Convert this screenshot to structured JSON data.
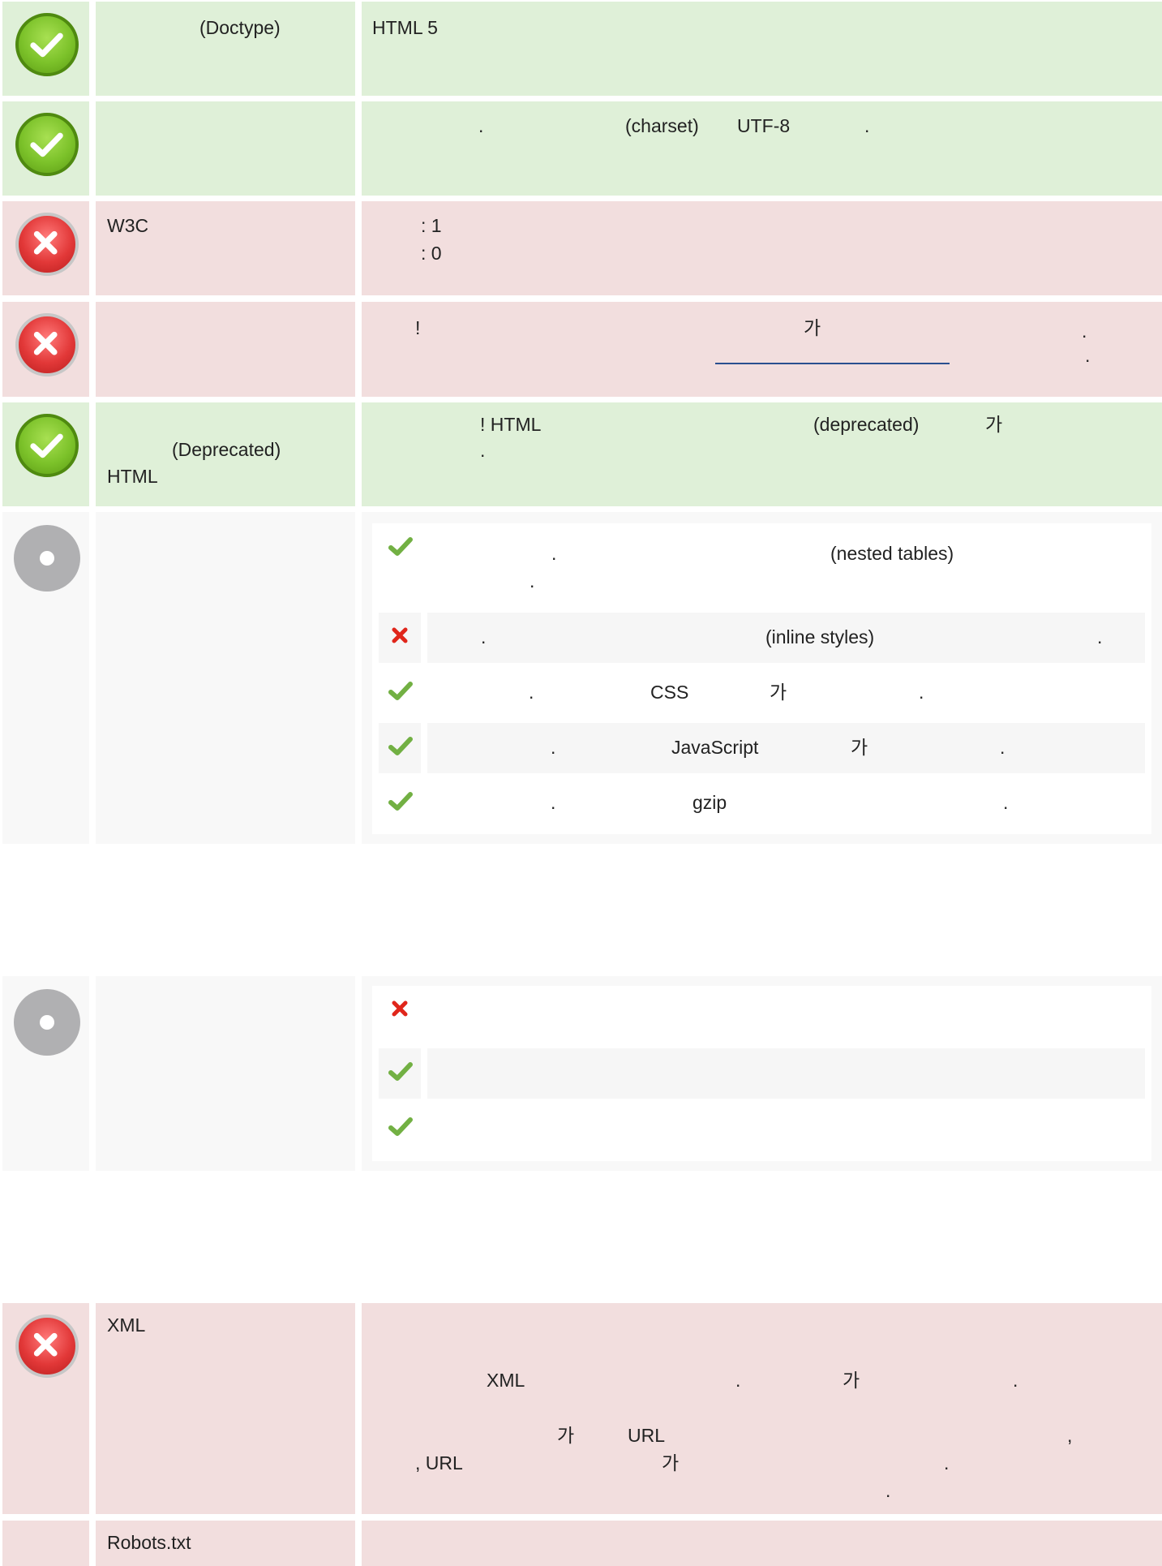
{
  "icons": {
    "pass": "check-circle-icon",
    "fail": "x-circle-icon",
    "info": "info-circle-icon",
    "sub_pass": "checkmark-icon",
    "sub_fail": "cross-icon"
  },
  "colors": {
    "pass_bg": "#dff0d8",
    "fail_bg": "#f2dede",
    "info_bg": "#f8f8f8",
    "check": "#72b043",
    "cross": "#e0261b",
    "link": "#2a4f8f"
  },
  "doctype": {
    "name": "(Doctype)",
    "value": "HTML 5"
  },
  "encoding": {
    "desc_period": ".",
    "charset": "(charset)",
    "utf8": "UTF-8",
    "desc_period2": "."
  },
  "w3c": {
    "name": "W3C",
    "errors": ": 1",
    "warnings": ": 0"
  },
  "notice": {
    "exclaim": "!",
    "ga": "가",
    "period1": ".",
    "period2": "."
  },
  "deprecated": {
    "name_line1": "(Deprecated)",
    "name_line2": "HTML",
    "exclaim_html": "! HTML",
    "deprecated_word": "(deprecated)",
    "ga": "가",
    "period": "."
  },
  "speed": {
    "items": [
      {
        "status": "pass",
        "p1": ".",
        "key": "(nested tables)",
        "p2": "."
      },
      {
        "status": "fail",
        "p1": ".",
        "key": "(inline styles)",
        "p2": "."
      },
      {
        "status": "pass",
        "p1": ".",
        "key": "CSS",
        "ga": "가",
        "p2": "."
      },
      {
        "status": "pass",
        "p1": ".",
        "key": "JavaScript",
        "ga": "가",
        "p2": "."
      },
      {
        "status": "pass",
        "p1": ".",
        "key": "gzip",
        "p2": "."
      }
    ]
  },
  "analytics": {
    "items": [
      {
        "status": "fail"
      },
      {
        "status": "pass"
      },
      {
        "status": "pass"
      }
    ]
  },
  "sitemap": {
    "name": "XML",
    "xml": "XML",
    "p1": ".",
    "ga1": "가",
    "p2": ".",
    "ga2": "가",
    "url1": "URL",
    "comma": ",",
    "url2": ", URL",
    "ga3": "가",
    "p3": ".",
    "p4": "."
  },
  "robots": {
    "name": "Robots.txt"
  }
}
